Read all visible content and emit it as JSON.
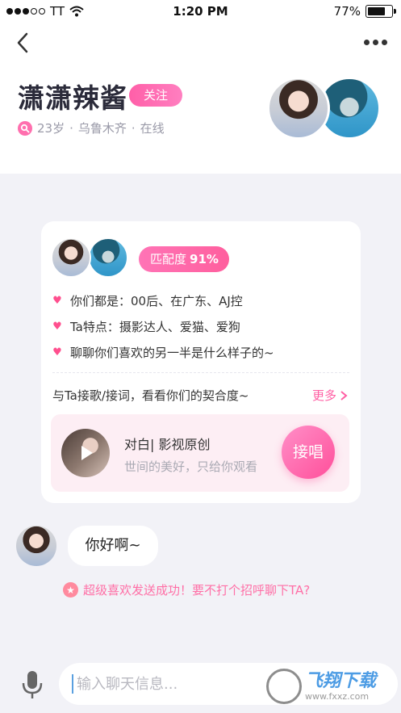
{
  "status_bar": {
    "carrier": "TT",
    "time": "1:20 PM",
    "battery": "77%",
    "battery_level": 0.77
  },
  "header": {
    "back_icon": "chevron-left-icon",
    "more_icon": "more-dots-icon"
  },
  "profile": {
    "name": "潇潇辣酱",
    "follow_label": "关注",
    "age": "23岁",
    "city": "乌鲁木齐",
    "status": "在线",
    "separator": "·"
  },
  "match_card": {
    "match_label": "匹配度",
    "match_value": "91%",
    "traits": [
      "你们都是：00后、在广东、AJ控",
      "Ta特点：摄影达人、爱猫、爱狗",
      "聊聊你们喜欢的另一半是什么样子的~"
    ],
    "sing_prompt": "与Ta接歌/接词，看看你们的契合度~",
    "more_label": "更多",
    "song": {
      "title": "对白| 影视原创",
      "subtitle": "世间的美好，只给你观看",
      "sing_label": "接唱"
    }
  },
  "chat": {
    "message": "你好啊~",
    "system_message": "超级喜欢发送成功！要不打个招呼聊下TA?"
  },
  "input_bar": {
    "placeholder": "输入聊天信息..."
  },
  "watermark": {
    "text": "飞翔下载",
    "url": "www.fxxz.com"
  },
  "colors": {
    "accent_pink": "#ff5fa4",
    "background": "#f2f2f7"
  }
}
